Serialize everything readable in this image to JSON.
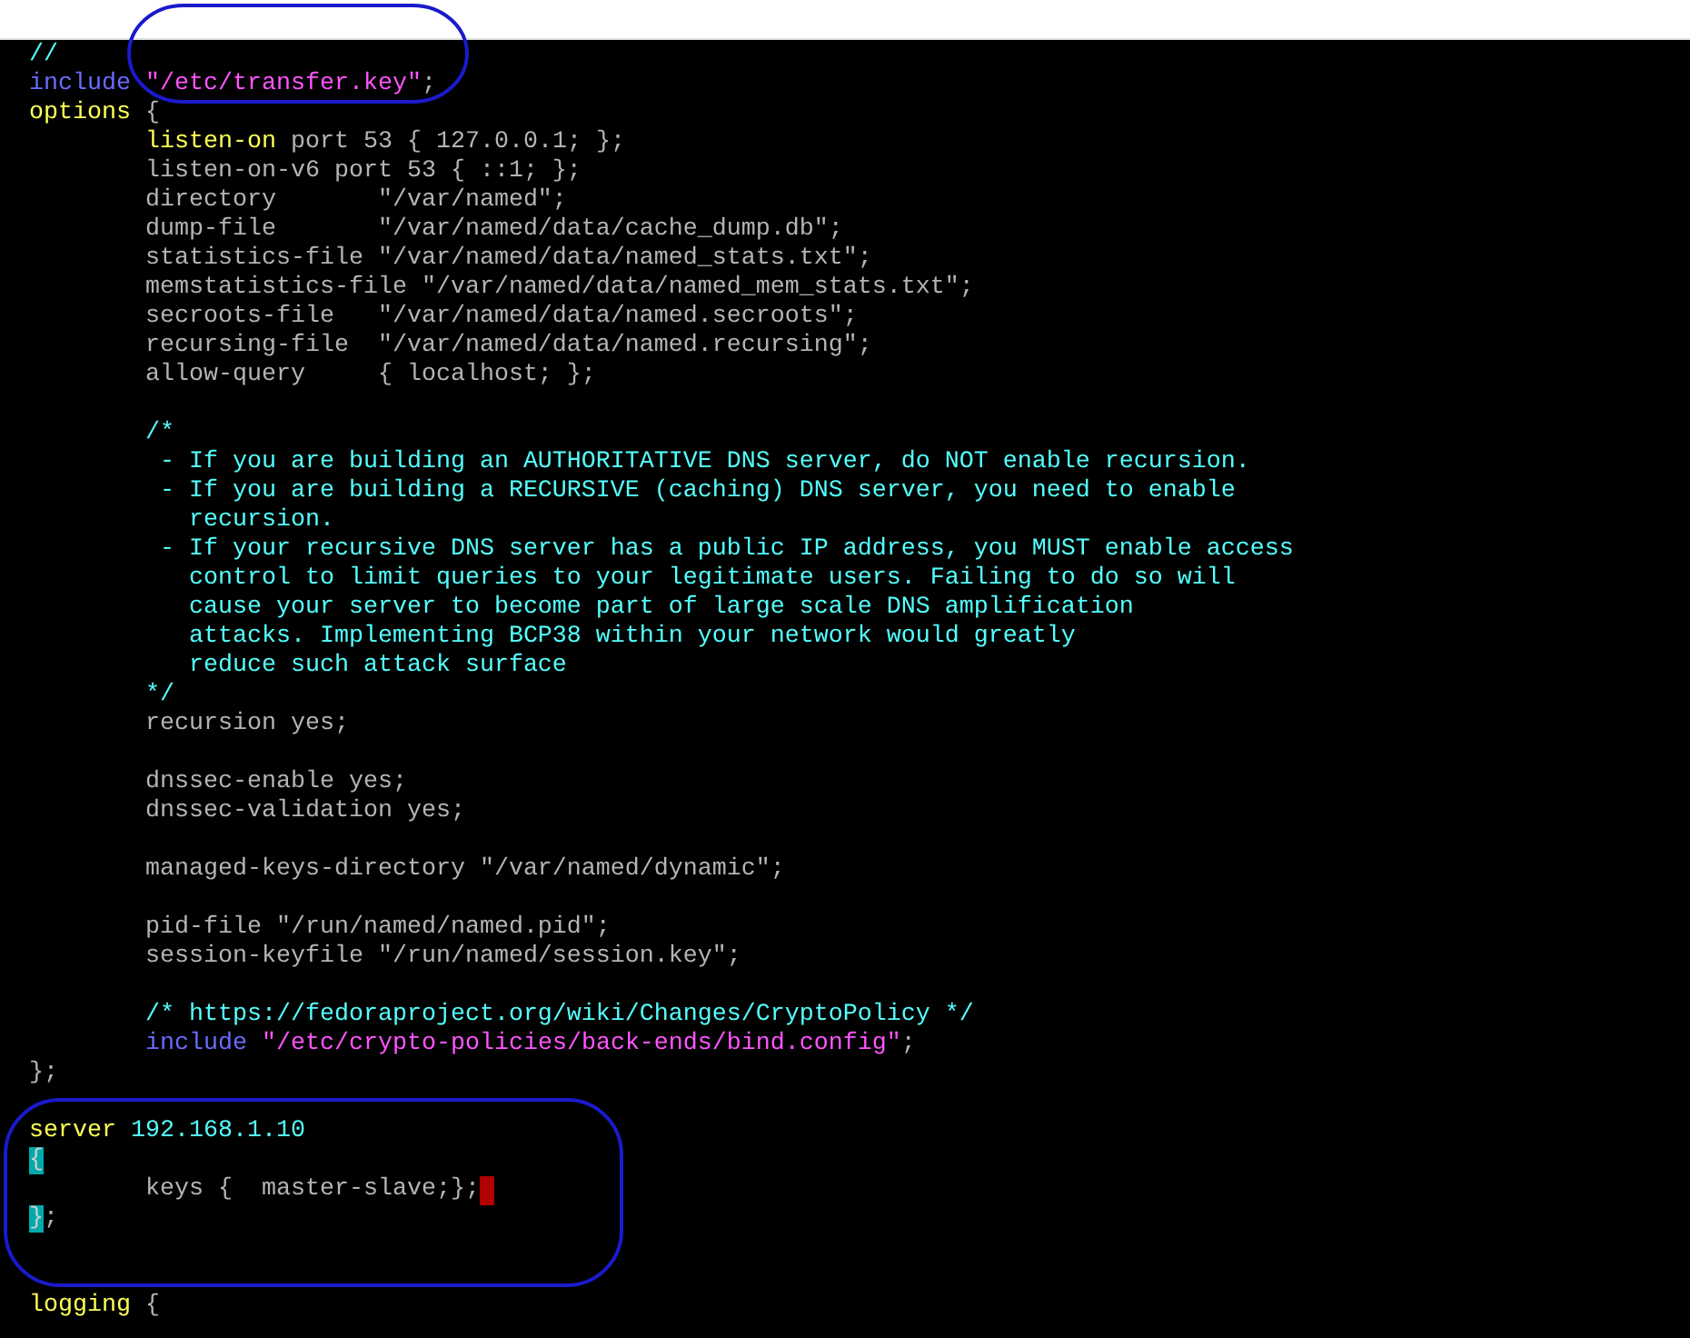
{
  "editor": {
    "lines": [
      {
        "kind": "code",
        "segments": [
          {
            "kind": "comment",
            "text": "//"
          }
        ]
      },
      {
        "kind": "code",
        "segments": [
          {
            "kind": "include",
            "text": "include "
          },
          {
            "kind": "string",
            "text": "\"/etc/transfer.key\""
          },
          {
            "kind": "plain",
            "text": ";"
          }
        ]
      },
      {
        "kind": "code",
        "segments": [
          {
            "kind": "keyword",
            "text": "options"
          },
          {
            "kind": "plain",
            "text": " {"
          }
        ]
      },
      {
        "kind": "code",
        "segments": [
          {
            "kind": "keyword",
            "text": "        listen-on"
          },
          {
            "kind": "plain",
            "text": " port 53 { 127.0.0.1; };"
          }
        ]
      },
      {
        "kind": "code",
        "segments": [
          {
            "kind": "plain",
            "text": "        listen-on-v6 port 53 { ::1; };"
          }
        ]
      },
      {
        "kind": "code",
        "segments": [
          {
            "kind": "plain",
            "text": "        directory       \"/var/named\";"
          }
        ]
      },
      {
        "kind": "code",
        "segments": [
          {
            "kind": "plain",
            "text": "        dump-file       \"/var/named/data/cache_dump.db\";"
          }
        ]
      },
      {
        "kind": "code",
        "segments": [
          {
            "kind": "plain",
            "text": "        statistics-file \"/var/named/data/named_stats.txt\";"
          }
        ]
      },
      {
        "kind": "code",
        "segments": [
          {
            "kind": "plain",
            "text": "        memstatistics-file \"/var/named/data/named_mem_stats.txt\";"
          }
        ]
      },
      {
        "kind": "code",
        "segments": [
          {
            "kind": "plain",
            "text": "        secroots-file   \"/var/named/data/named.secroots\";"
          }
        ]
      },
      {
        "kind": "code",
        "segments": [
          {
            "kind": "plain",
            "text": "        recursing-file  \"/var/named/data/named.recursing\";"
          }
        ]
      },
      {
        "kind": "code",
        "segments": [
          {
            "kind": "plain",
            "text": "        allow-query     { localhost; };"
          }
        ]
      },
      {
        "kind": "blank"
      },
      {
        "kind": "code",
        "segments": [
          {
            "kind": "comment",
            "text": "        /*"
          }
        ]
      },
      {
        "kind": "code",
        "segments": [
          {
            "kind": "comment",
            "text": "         - If you are building an AUTHORITATIVE DNS server, do NOT enable recursion."
          }
        ]
      },
      {
        "kind": "code",
        "segments": [
          {
            "kind": "comment",
            "text": "         - If you are building a RECURSIVE (caching) DNS server, you need to enable"
          }
        ]
      },
      {
        "kind": "code",
        "segments": [
          {
            "kind": "comment",
            "text": "           recursion."
          }
        ]
      },
      {
        "kind": "code",
        "segments": [
          {
            "kind": "comment",
            "text": "         - If your recursive DNS server has a public IP address, you MUST enable access"
          }
        ]
      },
      {
        "kind": "code",
        "segments": [
          {
            "kind": "comment",
            "text": "           control to limit queries to your legitimate users. Failing to do so will"
          }
        ]
      },
      {
        "kind": "code",
        "segments": [
          {
            "kind": "comment",
            "text": "           cause your server to become part of large scale DNS amplification"
          }
        ]
      },
      {
        "kind": "code",
        "segments": [
          {
            "kind": "comment",
            "text": "           attacks. Implementing BCP38 within your network would greatly"
          }
        ]
      },
      {
        "kind": "code",
        "segments": [
          {
            "kind": "comment",
            "text": "           reduce such attack surface"
          }
        ]
      },
      {
        "kind": "code",
        "segments": [
          {
            "kind": "comment",
            "text": "        */"
          }
        ]
      },
      {
        "kind": "code",
        "segments": [
          {
            "kind": "plain",
            "text": "        recursion yes;"
          }
        ]
      },
      {
        "kind": "blank"
      },
      {
        "kind": "code",
        "segments": [
          {
            "kind": "plain",
            "text": "        dnssec-enable yes;"
          }
        ]
      },
      {
        "kind": "code",
        "segments": [
          {
            "kind": "plain",
            "text": "        dnssec-validation yes;"
          }
        ]
      },
      {
        "kind": "blank"
      },
      {
        "kind": "code",
        "segments": [
          {
            "kind": "plain",
            "text": "        managed-keys-directory \"/var/named/dynamic\";"
          }
        ]
      },
      {
        "kind": "blank"
      },
      {
        "kind": "code",
        "segments": [
          {
            "kind": "plain",
            "text": "        pid-file \"/run/named/named.pid\";"
          }
        ]
      },
      {
        "kind": "code",
        "segments": [
          {
            "kind": "plain",
            "text": "        session-keyfile \"/run/named/session.key\";"
          }
        ]
      },
      {
        "kind": "blank"
      },
      {
        "kind": "code",
        "segments": [
          {
            "kind": "comment",
            "text": "        /* https://fedoraproject.org/wiki/Changes/CryptoPolicy */"
          }
        ]
      },
      {
        "kind": "code",
        "segments": [
          {
            "kind": "include",
            "text": "        include "
          },
          {
            "kind": "string",
            "text": "\"/etc/crypto-policies/back-ends/bind.config\""
          },
          {
            "kind": "plain",
            "text": ";"
          }
        ]
      },
      {
        "kind": "code",
        "segments": [
          {
            "kind": "plain",
            "text": "};"
          }
        ]
      },
      {
        "kind": "blank"
      },
      {
        "kind": "code",
        "segments": [
          {
            "kind": "keyword",
            "text": "server "
          },
          {
            "kind": "number",
            "text": "192.168.1.10"
          }
        ]
      },
      {
        "kind": "code",
        "segments": [
          {
            "kind": "match",
            "text": "{"
          }
        ]
      },
      {
        "kind": "code",
        "segments": [
          {
            "kind": "plain",
            "text": "        keys {  master-slave;};"
          }
        ],
        "cursor": true
      },
      {
        "kind": "code",
        "segments": [
          {
            "kind": "match",
            "text": "}"
          },
          {
            "kind": "plain",
            "text": ";"
          }
        ]
      },
      {
        "kind": "blank"
      },
      {
        "kind": "blank"
      },
      {
        "kind": "code",
        "segments": [
          {
            "kind": "keyword",
            "text": "logging"
          },
          {
            "kind": "plain",
            "text": " {"
          }
        ]
      }
    ]
  },
  "annotations": [
    {
      "kind": "loop"
    },
    {
      "kind": "loop"
    }
  ]
}
